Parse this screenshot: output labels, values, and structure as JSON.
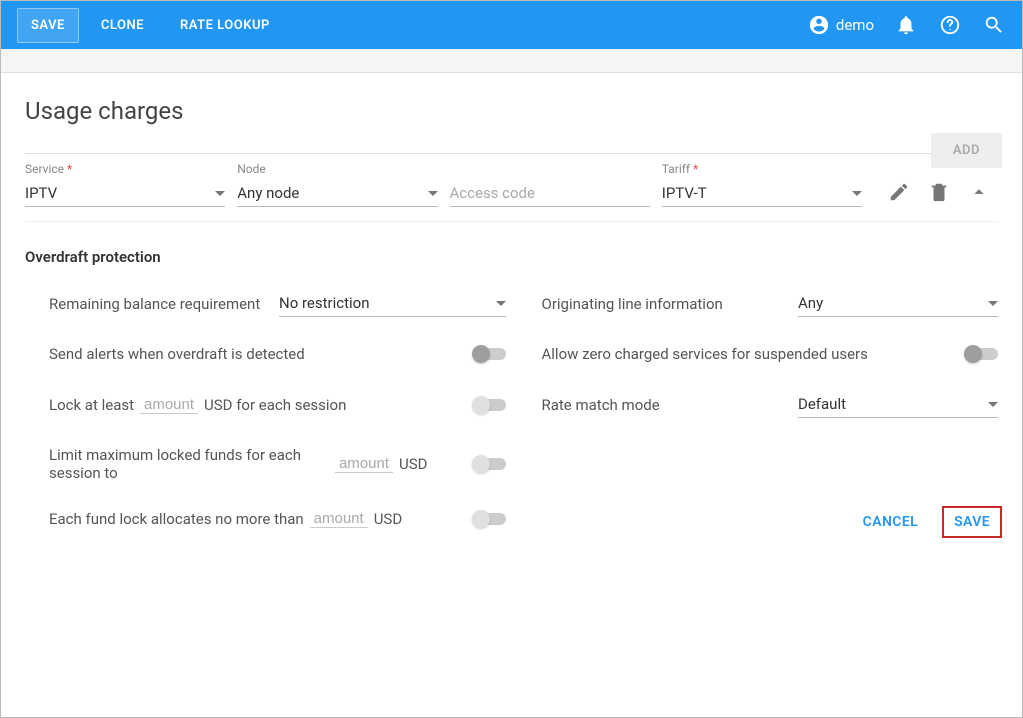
{
  "topbar": {
    "save": "SAVE",
    "clone": "CLONE",
    "rate_lookup": "RATE LOOKUP",
    "user": "demo"
  },
  "page": {
    "title": "Usage charges",
    "add": "ADD"
  },
  "charge": {
    "service_label": "Service",
    "service_val": "IPTV",
    "node_label": "Node",
    "node_val": "Any node",
    "access_label": "",
    "access_placeholder": "Access code",
    "tariff_label": "Tariff",
    "tariff_val": "IPTV-T"
  },
  "overdraft": {
    "title": "Overdraft protection",
    "remaining_label": "Remaining balance requirement",
    "remaining_val": "No restriction",
    "oli_label": "Originating line information",
    "oli_val": "Any",
    "send_alerts_label": "Send alerts when overdraft is detected",
    "allow_zero_label": "Allow zero charged services for suspended users",
    "lock_prefix": "Lock at least",
    "lock_suffix": "USD for each session",
    "amount_ph": "amount",
    "rate_match_label": "Rate match mode",
    "rate_match_val": "Default",
    "limit_label": "Limit maximum locked funds for each session to",
    "usd": "USD",
    "each_fund_label": "Each fund lock allocates no more than"
  },
  "footer": {
    "cancel": "CANCEL",
    "save": "SAVE"
  }
}
